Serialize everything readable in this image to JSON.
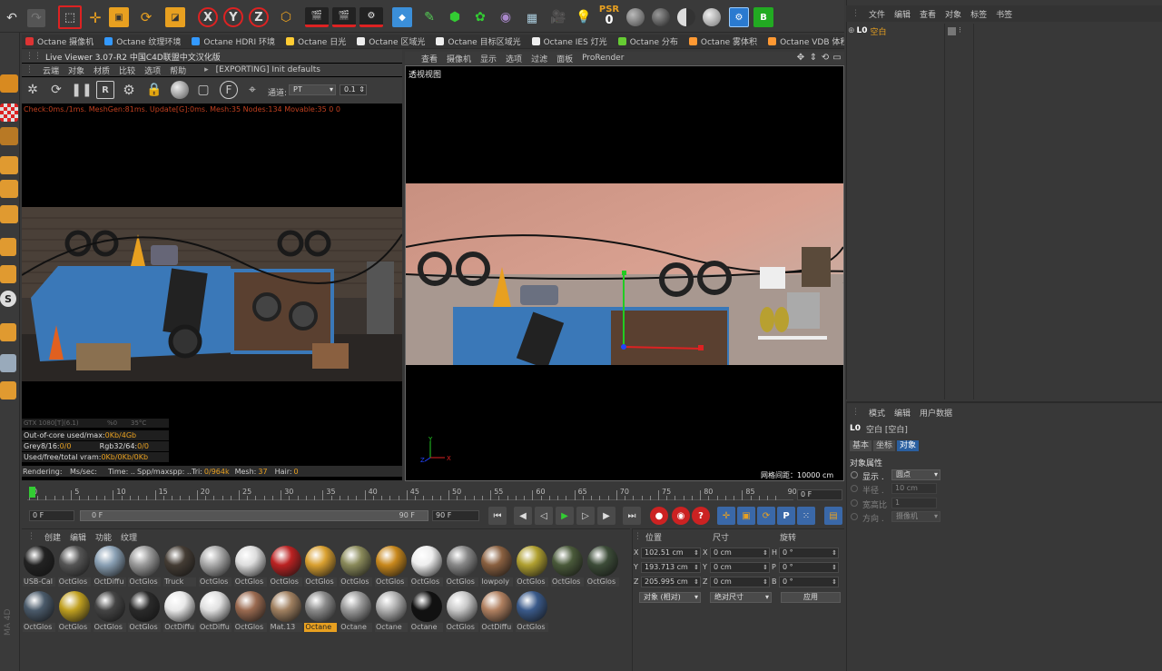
{
  "toolbar_top": {
    "psr_label": "PSR",
    "psr_value": "0"
  },
  "render_tabs": [
    {
      "label": "Octane 摄像机",
      "color": "#d33"
    },
    {
      "label": "Octane 纹理环境",
      "color": "#39f"
    },
    {
      "label": "Octane HDRI 环境",
      "color": "#39f"
    },
    {
      "label": "Octane 日光",
      "color": "#fc3"
    },
    {
      "label": "Octane 区域光",
      "color": "#eee"
    },
    {
      "label": "Octane 目标区域光",
      "color": "#eee"
    },
    {
      "label": "Octane IES 灯光",
      "color": "#eee"
    },
    {
      "label": "Octane 分布",
      "color": "#6c3"
    },
    {
      "label": "Octane 雾体积",
      "color": "#f93"
    },
    {
      "label": "Octane VDB 体积",
      "color": "#f93"
    }
  ],
  "live_viewer": {
    "title": "Live Viewer 3.07-R2 中国C4D联盟中文汉化版",
    "menu": [
      "云端",
      "对象",
      "材质",
      "比较",
      "选项",
      "帮助"
    ],
    "status_msg": "[EXPORTING] Init defaults",
    "channel_label": "通道:",
    "channel_value": "PT",
    "channel_value2": "0.1",
    "info_line": "Check:0ms./1ms. MeshGen:81ms. Update[G]:0ms. Mesh:35 Nodes:134 Movable:35  0 0",
    "gpu_row": {
      "name": "GTX 1080[T](6.1)",
      "pct": "%0",
      "temp": "35°C"
    },
    "stats": [
      {
        "label": "Out-of-core used/max:",
        "value": "0Kb/4Gb"
      },
      {
        "label": "Grey8/16:",
        "value": "0/0",
        "label2": "Rgb32/64:",
        "value2": "0/0"
      },
      {
        "label": "Used/free/total vram:",
        "value": "0Kb/0Kb/0Kb"
      }
    ],
    "bottom": {
      "rendering": "Rendering:",
      "ms": "Ms/sec:",
      "time": "Time: ..",
      "spp": "Spp/maxspp: ..",
      "tri_label": "Tri:",
      "tri": "0/964k",
      "mesh_label": "Mesh:",
      "mesh": "37",
      "hair_label": "Hair:",
      "hair": "0"
    }
  },
  "viewport": {
    "menu": [
      "查看",
      "摄像机",
      "显示",
      "选项",
      "过滤",
      "面板",
      "ProRender"
    ],
    "label": "透视视图",
    "grid_spacing": "网格间距：10000 cm"
  },
  "object_manager": {
    "menu": [
      "文件",
      "编辑",
      "查看",
      "对象",
      "标签",
      "书签"
    ],
    "object_name": "空白"
  },
  "attributes": {
    "menu": [
      "模式",
      "编辑",
      "用户数据"
    ],
    "title": "空白 [空白]",
    "tabs": [
      "基本",
      "坐标",
      "对象"
    ],
    "section": "对象属性",
    "rows": [
      {
        "label": "显示 .",
        "value": "圆点"
      },
      {
        "label": "半径 .",
        "value": "10 cm"
      },
      {
        "label": "宽高比",
        "value": "1"
      },
      {
        "label": "方向 .",
        "value": "摄像机"
      }
    ]
  },
  "timeline": {
    "ticks": [
      "0",
      "5",
      "10",
      "15",
      "20",
      "25",
      "30",
      "35",
      "40",
      "45",
      "50",
      "55",
      "60",
      "65",
      "70",
      "75",
      "80",
      "85",
      "90"
    ],
    "frame_display": "0 F",
    "start": "0 F",
    "range_start": "0 F",
    "range_end": "90 F",
    "end": "90 F"
  },
  "materials": {
    "menu": [
      "创建",
      "编辑",
      "功能",
      "纹理"
    ],
    "row1": [
      {
        "label": "USB-Cal",
        "color": "#222"
      },
      {
        "label": "OctGlos",
        "color": "#555"
      },
      {
        "label": "OctDiffu",
        "color": "#8aa0b4"
      },
      {
        "label": "OctGlos",
        "color": "#9a9a9a"
      },
      {
        "label": "Truck",
        "color": "#443c34"
      },
      {
        "label": "OctGlos",
        "color": "#aaa"
      },
      {
        "label": "OctGlos",
        "color": "#ddd"
      },
      {
        "label": "OctGlos",
        "color": "#b22"
      },
      {
        "label": "OctGlos",
        "color": "#d9a030"
      },
      {
        "label": "OctGlos",
        "color": "#8a8a5a"
      },
      {
        "label": "OctGlos",
        "color": "#c8881c"
      },
      {
        "label": "OctGlos",
        "color": "#eee"
      },
      {
        "label": "OctGlos",
        "color": "#888"
      },
      {
        "label": "lowpoly",
        "color": "#8a6040"
      },
      {
        "label": "OctGlos",
        "color": "#b0a030"
      },
      {
        "label": "OctGlos",
        "color": "#4a5a3a"
      },
      {
        "label": "OctGlos",
        "color": "#3c4c38"
      }
    ],
    "row2": [
      {
        "label": "OctGlos",
        "color": "#4a5a6a"
      },
      {
        "label": "OctGlos",
        "color": "#c0a020"
      },
      {
        "label": "OctGlos",
        "color": "#444"
      },
      {
        "label": "OctGlos",
        "color": "#2a2a2a"
      },
      {
        "label": "OctDiffu",
        "color": "#e8e8e8"
      },
      {
        "label": "OctDiffu",
        "color": "#e0e0e0"
      },
      {
        "label": "OctGlos",
        "color": "#9a6a50"
      },
      {
        "label": "Mat.13",
        "color": "#a08060"
      },
      {
        "label": "Octane",
        "color": "#8a8a8a"
      },
      {
        "label": "Octane",
        "color": "#9a9a9a"
      },
      {
        "label": "Octane",
        "color": "#b0b0b0"
      },
      {
        "label": "Octane",
        "color": "#111"
      },
      {
        "label": "OctGlos",
        "color": "#c8c8c8"
      },
      {
        "label": "OctDiffu",
        "color": "#b08060"
      },
      {
        "label": "OctGlos",
        "color": "#3a5a8a"
      }
    ]
  },
  "coords": {
    "headers": [
      "位置",
      "尺寸",
      "旋转"
    ],
    "rows": [
      {
        "axis": "X",
        "pos": "102.51 cm",
        "saxis": "X",
        "size": "0 cm",
        "raxis": "H",
        "rot": "0 °"
      },
      {
        "axis": "Y",
        "pos": "193.713 cm",
        "saxis": "Y",
        "size": "0 cm",
        "raxis": "P",
        "rot": "0 °"
      },
      {
        "axis": "Z",
        "pos": "205.995 cm",
        "saxis": "Z",
        "size": "0 cm",
        "raxis": "B",
        "rot": "0 °"
      }
    ],
    "mode": "对象 (相对)",
    "size_mode": "绝对尺寸",
    "apply": "应用"
  }
}
